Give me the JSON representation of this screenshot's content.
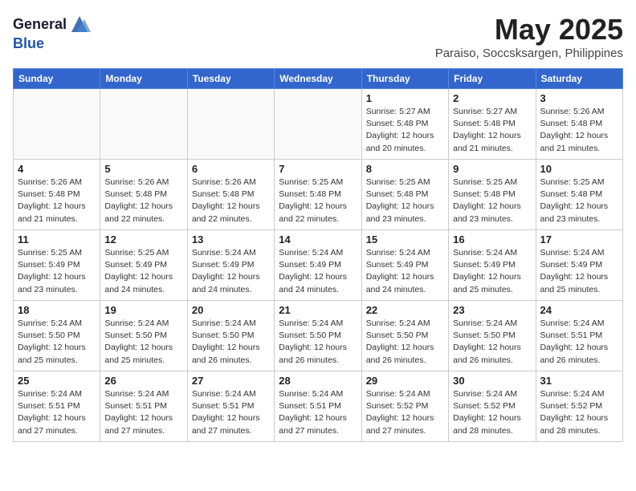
{
  "header": {
    "logo_general": "General",
    "logo_blue": "Blue",
    "month_title": "May 2025",
    "location": "Paraiso, Soccsksargen, Philippines"
  },
  "days_of_week": [
    "Sunday",
    "Monday",
    "Tuesday",
    "Wednesday",
    "Thursday",
    "Friday",
    "Saturday"
  ],
  "weeks": [
    [
      {
        "day": "",
        "info": ""
      },
      {
        "day": "",
        "info": ""
      },
      {
        "day": "",
        "info": ""
      },
      {
        "day": "",
        "info": ""
      },
      {
        "day": "1",
        "info": "Sunrise: 5:27 AM\nSunset: 5:48 PM\nDaylight: 12 hours\nand 20 minutes."
      },
      {
        "day": "2",
        "info": "Sunrise: 5:27 AM\nSunset: 5:48 PM\nDaylight: 12 hours\nand 21 minutes."
      },
      {
        "day": "3",
        "info": "Sunrise: 5:26 AM\nSunset: 5:48 PM\nDaylight: 12 hours\nand 21 minutes."
      }
    ],
    [
      {
        "day": "4",
        "info": "Sunrise: 5:26 AM\nSunset: 5:48 PM\nDaylight: 12 hours\nand 21 minutes."
      },
      {
        "day": "5",
        "info": "Sunrise: 5:26 AM\nSunset: 5:48 PM\nDaylight: 12 hours\nand 22 minutes."
      },
      {
        "day": "6",
        "info": "Sunrise: 5:26 AM\nSunset: 5:48 PM\nDaylight: 12 hours\nand 22 minutes."
      },
      {
        "day": "7",
        "info": "Sunrise: 5:25 AM\nSunset: 5:48 PM\nDaylight: 12 hours\nand 22 minutes."
      },
      {
        "day": "8",
        "info": "Sunrise: 5:25 AM\nSunset: 5:48 PM\nDaylight: 12 hours\nand 23 minutes."
      },
      {
        "day": "9",
        "info": "Sunrise: 5:25 AM\nSunset: 5:48 PM\nDaylight: 12 hours\nand 23 minutes."
      },
      {
        "day": "10",
        "info": "Sunrise: 5:25 AM\nSunset: 5:48 PM\nDaylight: 12 hours\nand 23 minutes."
      }
    ],
    [
      {
        "day": "11",
        "info": "Sunrise: 5:25 AM\nSunset: 5:49 PM\nDaylight: 12 hours\nand 23 minutes."
      },
      {
        "day": "12",
        "info": "Sunrise: 5:25 AM\nSunset: 5:49 PM\nDaylight: 12 hours\nand 24 minutes."
      },
      {
        "day": "13",
        "info": "Sunrise: 5:24 AM\nSunset: 5:49 PM\nDaylight: 12 hours\nand 24 minutes."
      },
      {
        "day": "14",
        "info": "Sunrise: 5:24 AM\nSunset: 5:49 PM\nDaylight: 12 hours\nand 24 minutes."
      },
      {
        "day": "15",
        "info": "Sunrise: 5:24 AM\nSunset: 5:49 PM\nDaylight: 12 hours\nand 24 minutes."
      },
      {
        "day": "16",
        "info": "Sunrise: 5:24 AM\nSunset: 5:49 PM\nDaylight: 12 hours\nand 25 minutes."
      },
      {
        "day": "17",
        "info": "Sunrise: 5:24 AM\nSunset: 5:49 PM\nDaylight: 12 hours\nand 25 minutes."
      }
    ],
    [
      {
        "day": "18",
        "info": "Sunrise: 5:24 AM\nSunset: 5:50 PM\nDaylight: 12 hours\nand 25 minutes."
      },
      {
        "day": "19",
        "info": "Sunrise: 5:24 AM\nSunset: 5:50 PM\nDaylight: 12 hours\nand 25 minutes."
      },
      {
        "day": "20",
        "info": "Sunrise: 5:24 AM\nSunset: 5:50 PM\nDaylight: 12 hours\nand 26 minutes."
      },
      {
        "day": "21",
        "info": "Sunrise: 5:24 AM\nSunset: 5:50 PM\nDaylight: 12 hours\nand 26 minutes."
      },
      {
        "day": "22",
        "info": "Sunrise: 5:24 AM\nSunset: 5:50 PM\nDaylight: 12 hours\nand 26 minutes."
      },
      {
        "day": "23",
        "info": "Sunrise: 5:24 AM\nSunset: 5:50 PM\nDaylight: 12 hours\nand 26 minutes."
      },
      {
        "day": "24",
        "info": "Sunrise: 5:24 AM\nSunset: 5:51 PM\nDaylight: 12 hours\nand 26 minutes."
      }
    ],
    [
      {
        "day": "25",
        "info": "Sunrise: 5:24 AM\nSunset: 5:51 PM\nDaylight: 12 hours\nand 27 minutes."
      },
      {
        "day": "26",
        "info": "Sunrise: 5:24 AM\nSunset: 5:51 PM\nDaylight: 12 hours\nand 27 minutes."
      },
      {
        "day": "27",
        "info": "Sunrise: 5:24 AM\nSunset: 5:51 PM\nDaylight: 12 hours\nand 27 minutes."
      },
      {
        "day": "28",
        "info": "Sunrise: 5:24 AM\nSunset: 5:51 PM\nDaylight: 12 hours\nand 27 minutes."
      },
      {
        "day": "29",
        "info": "Sunrise: 5:24 AM\nSunset: 5:52 PM\nDaylight: 12 hours\nand 27 minutes."
      },
      {
        "day": "30",
        "info": "Sunrise: 5:24 AM\nSunset: 5:52 PM\nDaylight: 12 hours\nand 28 minutes."
      },
      {
        "day": "31",
        "info": "Sunrise: 5:24 AM\nSunset: 5:52 PM\nDaylight: 12 hours\nand 28 minutes."
      }
    ]
  ]
}
